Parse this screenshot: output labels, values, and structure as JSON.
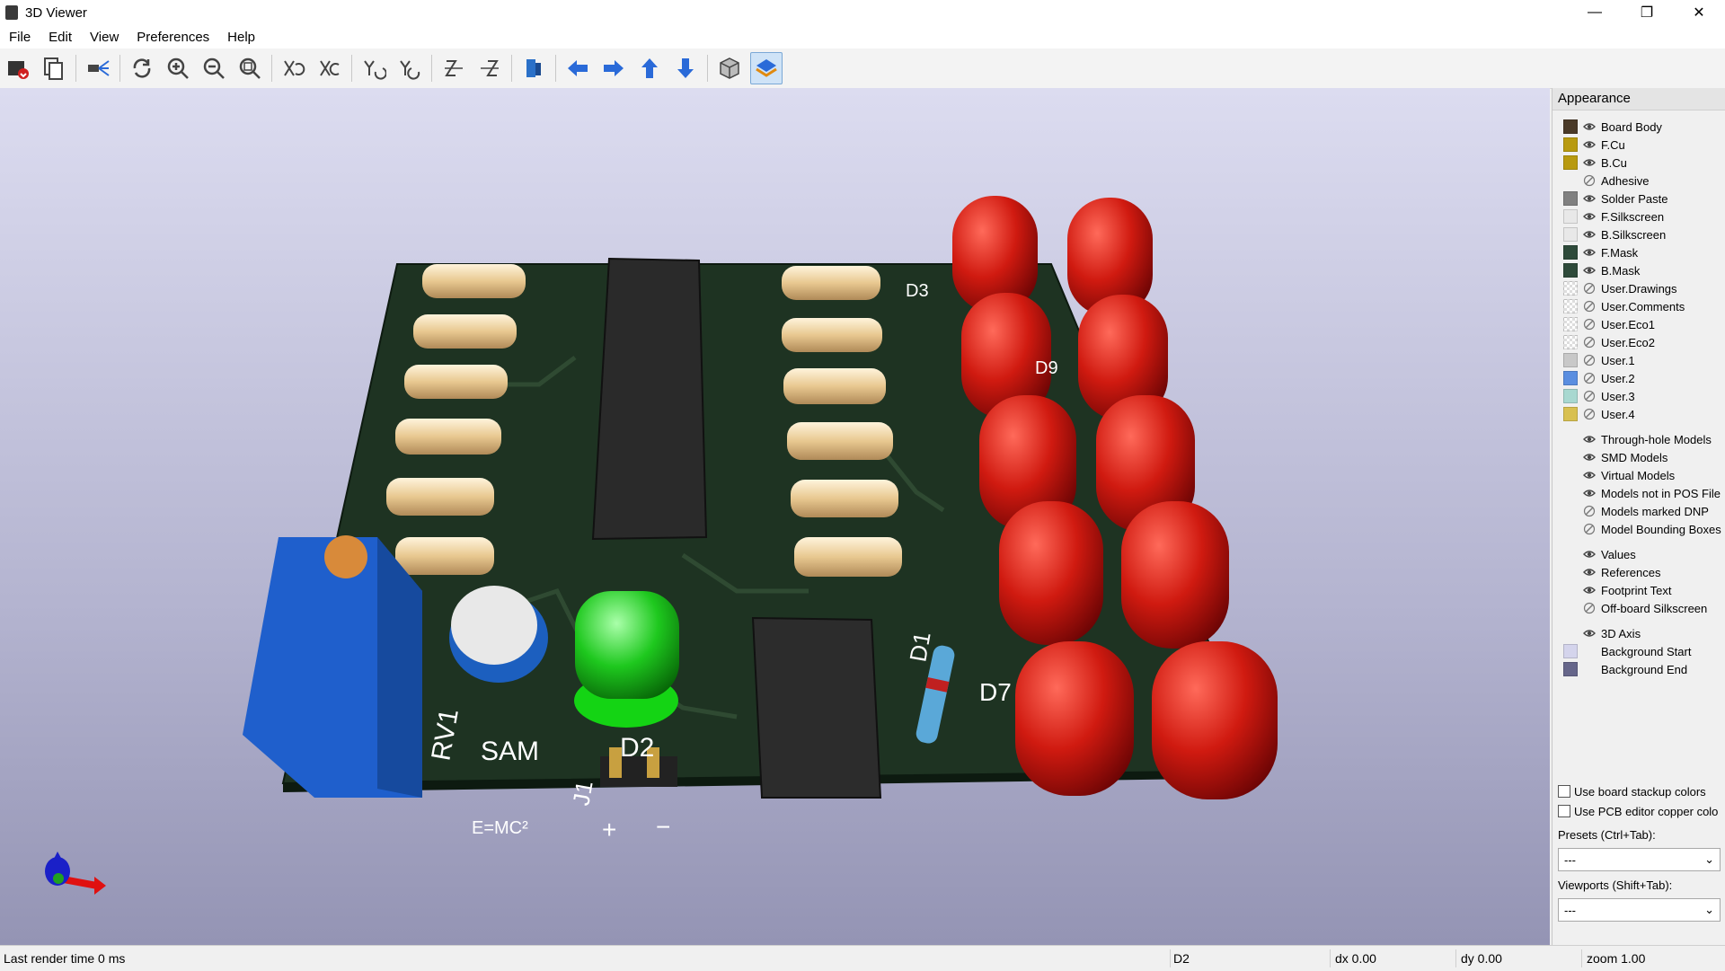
{
  "window": {
    "title": "3D Viewer",
    "minimize": "—",
    "maximize": "❐",
    "close": "✕"
  },
  "menu": [
    "File",
    "Edit",
    "View",
    "Preferences",
    "Help"
  ],
  "toolbar_icons": [
    "export-image-icon",
    "copy-icon",
    "raytrace-icon",
    "reload-icon",
    "zoom-in-icon",
    "zoom-out-icon",
    "zoom-fit-icon",
    "rotate-x-cw-icon",
    "rotate-x-ccw-icon",
    "rotate-y-cw-icon",
    "rotate-y-ccw-icon",
    "rotate-z-cw-icon",
    "rotate-z-ccw-icon",
    "flip-board-icon",
    "pan-left-icon",
    "pan-right-icon",
    "pan-up-icon",
    "pan-down-icon",
    "ortho-toggle-icon",
    "layers-manager-icon"
  ],
  "appearance": {
    "title": "Appearance",
    "layers": [
      {
        "label": "Board Body",
        "color": "#4a3a28",
        "eye": "visible"
      },
      {
        "label": "F.Cu",
        "color": "#b89a10",
        "eye": "visible"
      },
      {
        "label": "B.Cu",
        "color": "#b89a10",
        "eye": "visible"
      },
      {
        "label": "Adhesive",
        "color": "",
        "eye": "hidden"
      },
      {
        "label": "Solder Paste",
        "color": "#808080",
        "eye": "visible"
      },
      {
        "label": "F.Silkscreen",
        "color": "#e8e8e8",
        "eye": "visible"
      },
      {
        "label": "B.Silkscreen",
        "color": "#e8e8e8",
        "eye": "visible"
      },
      {
        "label": "F.Mask",
        "color": "#2e4a3a",
        "eye": "visible"
      },
      {
        "label": "B.Mask",
        "color": "#2e4a3a",
        "eye": "visible"
      },
      {
        "label": "User.Drawings",
        "color": "checker",
        "eye": "hidden"
      },
      {
        "label": "User.Comments",
        "color": "checker",
        "eye": "hidden"
      },
      {
        "label": "User.Eco1",
        "color": "checker",
        "eye": "hidden"
      },
      {
        "label": "User.Eco2",
        "color": "checker",
        "eye": "hidden"
      },
      {
        "label": "User.1",
        "color": "#c8c8c8",
        "eye": "hidden"
      },
      {
        "label": "User.2",
        "color": "#5a8ee0",
        "eye": "hidden"
      },
      {
        "label": "User.3",
        "color": "#a8d8d0",
        "eye": "hidden"
      },
      {
        "label": "User.4",
        "color": "#d8c050",
        "eye": "hidden"
      }
    ],
    "models": [
      {
        "label": "Through-hole Models",
        "eye": "visible"
      },
      {
        "label": "SMD Models",
        "eye": "visible"
      },
      {
        "label": "Virtual Models",
        "eye": "visible"
      },
      {
        "label": "Models not in POS File",
        "eye": "visible"
      },
      {
        "label": "Models marked DNP",
        "eye": "hidden"
      },
      {
        "label": "Model Bounding Boxes",
        "eye": "hidden"
      }
    ],
    "text": [
      {
        "label": "Values",
        "eye": "visible"
      },
      {
        "label": "References",
        "eye": "visible"
      },
      {
        "label": "Footprint Text",
        "eye": "visible"
      },
      {
        "label": "Off-board Silkscreen",
        "eye": "hidden"
      }
    ],
    "misc": [
      {
        "label": "3D Axis",
        "color": "",
        "eye": "visible"
      },
      {
        "label": "Background Start",
        "color": "#d4d4ec",
        "eye": ""
      },
      {
        "label": "Background End",
        "color": "#66668a",
        "eye": ""
      }
    ],
    "use_stackup": "Use board stackup colors",
    "use_pcb_copper": "Use PCB editor copper colo",
    "presets_label": "Presets (Ctrl+Tab):",
    "presets_value": "---",
    "viewports_label": "Viewports (Shift+Tab):",
    "viewports_value": "---"
  },
  "status": {
    "render": "Last render time 0 ms",
    "item": "D2",
    "dx": "dx 0.00",
    "dy": "dy 0.00",
    "zoom": "zoom 1.00"
  },
  "pcb_text": {
    "rv1": "RV1",
    "sam": "SAM",
    "emc": "E=MC²",
    "d2": "D2",
    "j1": "J1",
    "plus": "+",
    "minus": "−",
    "d1": "D1",
    "d3": "D3",
    "d7": "D7",
    "d9": "D9"
  }
}
